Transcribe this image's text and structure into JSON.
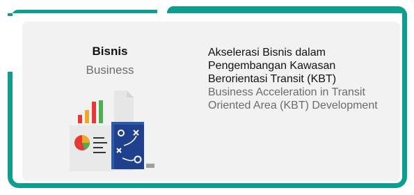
{
  "category": {
    "title": "Bisnis",
    "subtitle": "Business"
  },
  "description": {
    "id_lines": [
      "Akselerasi Bisnis dalam",
      "Pengembangan Kawasan",
      "Berorientasi Transit (KBT)"
    ],
    "en_lines": [
      "Business Acceleration in Transit",
      "Oriented Area (KBT)  Development"
    ]
  },
  "colors": {
    "accent": "#0e9e8f",
    "card": "#f2f2f2",
    "strategy_board": "#1f3f8f"
  },
  "icons": {
    "illustration": "business-report-strategy-icon"
  }
}
